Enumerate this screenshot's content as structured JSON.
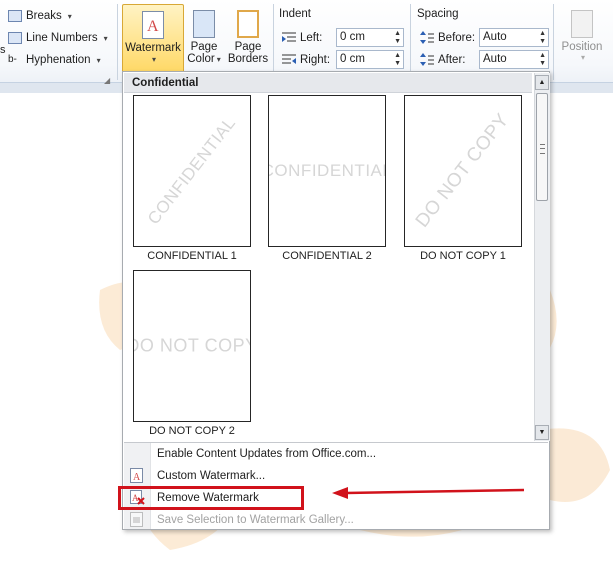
{
  "ribbon": {
    "page_setup": {
      "breaks": "Breaks",
      "line_numbers": "Line Numbers",
      "hyphenation": "Hyphenation",
      "left_partial": "s"
    },
    "watermark_label": "Watermark",
    "page_color_line1": "Page",
    "page_color_line2": "Color",
    "page_borders_line1": "Page",
    "page_borders_line2": "Borders",
    "indent": {
      "title": "Indent",
      "left_label": "Left:",
      "left_value": "0 cm",
      "right_label": "Right:",
      "right_value": "0 cm"
    },
    "spacing": {
      "title": "Spacing",
      "before_label": "Before:",
      "before_value": "Auto",
      "after_label": "After:",
      "after_value": "Auto"
    },
    "position_label": "Position"
  },
  "gallery": {
    "section_title": "Confidential",
    "items": [
      {
        "caption": "CONFIDENTIAL 1",
        "watermark_text": "CONFIDENTIAL",
        "diagonal": true
      },
      {
        "caption": "CONFIDENTIAL 2",
        "watermark_text": "CONFIDENTIAL",
        "diagonal": false
      },
      {
        "caption": "DO NOT COPY 1",
        "watermark_text": "DO NOT COPY",
        "diagonal": true
      },
      {
        "caption": "DO NOT COPY 2",
        "watermark_text": "DO NOT COPY",
        "diagonal": false
      }
    ]
  },
  "menu": {
    "enable_updates": "Enable Content Updates from Office.com...",
    "custom_watermark": "Custom Watermark...",
    "remove_watermark": "Remove Watermark",
    "save_selection": "Save Selection to Watermark Gallery..."
  },
  "colors": {
    "highlight_red": "#d1121b",
    "active_button": "#ffd865",
    "doodle": "#fbe6cc"
  },
  "icons": {
    "scroll_up": "▲",
    "scroll_down": "▼",
    "dropdown": "▾"
  }
}
